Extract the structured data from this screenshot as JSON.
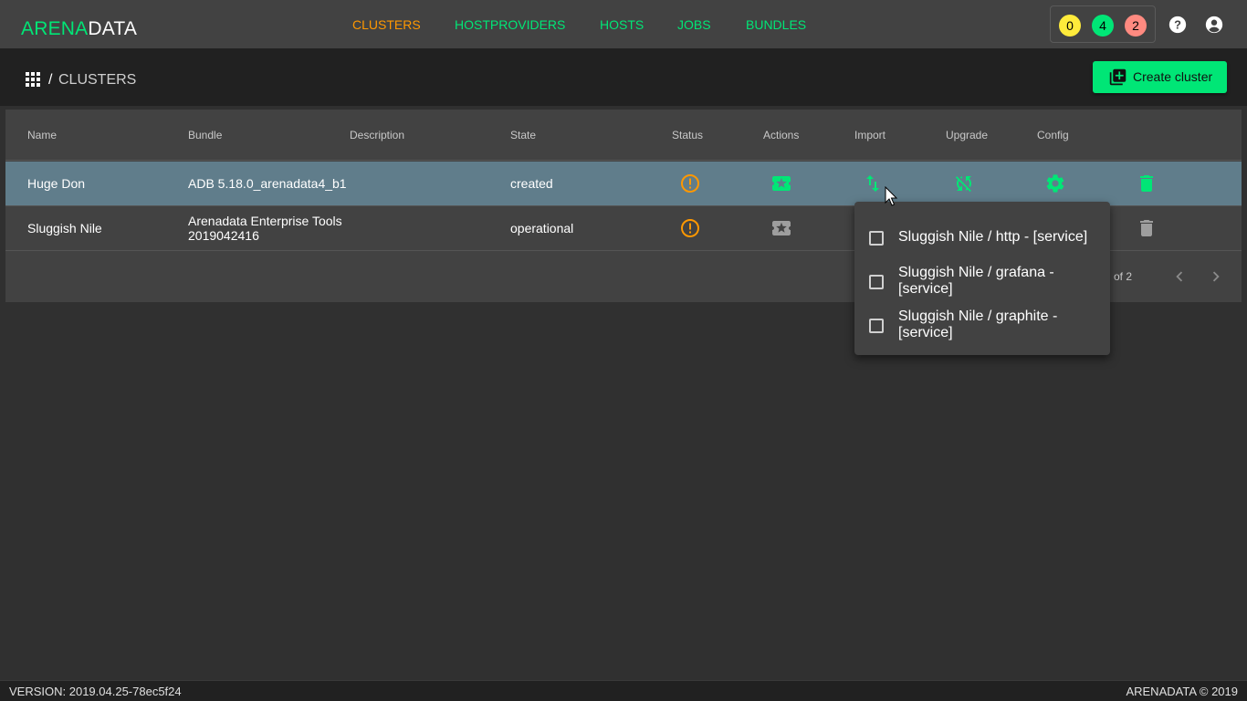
{
  "logo": {
    "part1": "ARENA",
    "part2": "DATA"
  },
  "nav": {
    "items": [
      {
        "label": "CLUSTERS",
        "active": true
      },
      {
        "label": "HOSTPROVIDERS",
        "active": false
      },
      {
        "label": "HOSTS",
        "active": false
      },
      {
        "label": "JOBS",
        "active": false
      },
      {
        "label": "BUNDLES",
        "active": false
      }
    ]
  },
  "counters": [
    {
      "value": "0",
      "color": "#ffeb3b"
    },
    {
      "value": "4",
      "color": "#00e676"
    },
    {
      "value": "2",
      "color": "#ff8a80"
    }
  ],
  "header_icons": [
    "help-icon",
    "account-icon"
  ],
  "breadcrumb": {
    "separator": "/",
    "current": "CLUSTERS"
  },
  "create_button": {
    "label": "Create cluster"
  },
  "table": {
    "columns": [
      "Name",
      "Bundle",
      "Description",
      "State",
      "Status",
      "Actions",
      "Import",
      "Upgrade",
      "Config"
    ],
    "rows": [
      {
        "name": "Huge Don",
        "bundle_line1": "ADB 5.18.0_arenadata4_b1",
        "bundle_line2": "",
        "description": "",
        "state": "created",
        "highlighted": true
      },
      {
        "name": "Sluggish Nile",
        "bundle_line1": "Arenadata Enterprise Tools",
        "bundle_line2": "2019042416",
        "description": "",
        "state": "operational",
        "highlighted": false
      }
    ]
  },
  "paginator": {
    "range_text": "of 2"
  },
  "import_menu": {
    "items": [
      {
        "label": "Sluggish Nile / http - [service]",
        "checked": false
      },
      {
        "label": "Sluggish Nile / grafana - [service]",
        "checked": false
      },
      {
        "label": "Sluggish Nile / graphite - [service]",
        "checked": false
      }
    ]
  },
  "footer": {
    "version": "VERSION: 2019.04.25-78ec5f24",
    "copyright": "ARENADATA © 2019"
  },
  "colors": {
    "accent": "#00e676",
    "active_nav": "#ff9800",
    "warning": "#ff9800",
    "row_highlight": "#607d8b"
  }
}
